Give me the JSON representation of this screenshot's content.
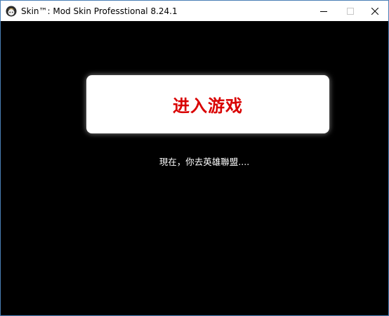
{
  "window": {
    "title": "Skin™: Mod Skin Professtional 8.24.1",
    "icon": "app-logo-icon",
    "controls": {
      "minimize_icon": "minimize-icon",
      "maximize_icon": "maximize-icon",
      "close_icon": "close-icon"
    }
  },
  "main": {
    "enter_button_label": "进入游戏",
    "status_text": "現在，你去英雄聯盟...."
  },
  "colors": {
    "background": "#000000",
    "button_background": "#ffffff",
    "button_text": "#d90000",
    "status_text": "#ffffff"
  }
}
